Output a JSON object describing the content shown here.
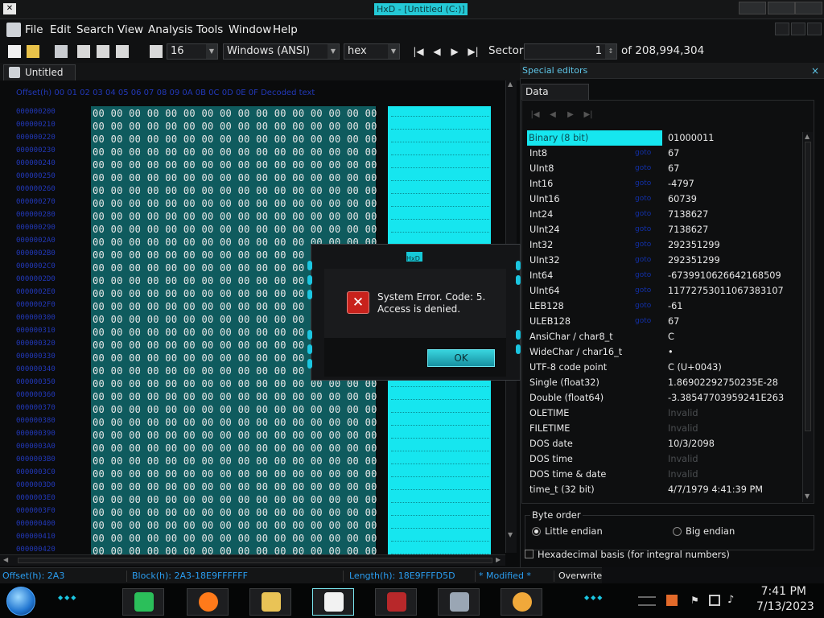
{
  "window": {
    "title": "HxD - [Untitled (C:)]",
    "app_icon": "HxD"
  },
  "menu": [
    "File",
    "Edit",
    "Search",
    "View",
    "Analysis",
    "Tools",
    "Window",
    "Help"
  ],
  "toolbar": {
    "bytes_per_row": "16",
    "charset": "Windows (ANSI)",
    "offset_base": "hex",
    "sector_label": "Sector",
    "sector_value": "1",
    "sector_total": "of 208,994,304"
  },
  "document_tab": "Untitled (C:)",
  "editor": {
    "header": "Offset(h) 00 01 02 03 04 05 06 07 08 09 0A 0B 0C 0D 0E 0F  Decoded text",
    "offsets": [
      "000000200",
      "000000210",
      "000000220",
      "000000230",
      "000000240",
      "000000250",
      "000000260",
      "000000270",
      "000000280",
      "000000290",
      "0000002A0",
      "0000002B0",
      "0000002C0",
      "0000002D0",
      "0000002E0",
      "0000002F0",
      "000000300",
      "000000310",
      "000000320",
      "000000330",
      "000000340",
      "000000350",
      "000000360",
      "000000370",
      "000000380",
      "000000390",
      "0000003A0",
      "0000003B0",
      "0000003C0",
      "0000003D0",
      "0000003E0",
      "0000003F0",
      "000000400",
      "000000410",
      "000000420"
    ],
    "hex_row": "00 00 00 00 00 00 00 00 00 00 00 00 00 00 00 00"
  },
  "special_editors": {
    "title": "Special editors",
    "close": "×",
    "tab": "Data inspector",
    "rows": [
      {
        "label": "Binary (8 bit)",
        "link": "",
        "value": "01000011",
        "invalid": false,
        "selected": true
      },
      {
        "label": "Int8",
        "link": "goto",
        "value": "67",
        "invalid": false
      },
      {
        "label": "UInt8",
        "link": "goto",
        "value": "67",
        "invalid": false
      },
      {
        "label": "Int16",
        "link": "goto",
        "value": "-4797",
        "invalid": false
      },
      {
        "label": "UInt16",
        "link": "goto",
        "value": "60739",
        "invalid": false
      },
      {
        "label": "Int24",
        "link": "goto",
        "value": "7138627",
        "invalid": false
      },
      {
        "label": "UInt24",
        "link": "goto",
        "value": "7138627",
        "invalid": false
      },
      {
        "label": "Int32",
        "link": "goto",
        "value": "292351299",
        "invalid": false
      },
      {
        "label": "UInt32",
        "link": "goto",
        "value": "292351299",
        "invalid": false
      },
      {
        "label": "Int64",
        "link": "goto",
        "value": "-6739910626642168509",
        "invalid": false
      },
      {
        "label": "UInt64",
        "link": "goto",
        "value": "11772753011067383107",
        "invalid": false
      },
      {
        "label": "LEB128",
        "link": "goto",
        "value": "-61",
        "invalid": false
      },
      {
        "label": "ULEB128",
        "link": "goto",
        "value": "67",
        "invalid": false
      },
      {
        "label": "AnsiChar / char8_t",
        "link": "",
        "value": "C",
        "invalid": false
      },
      {
        "label": "WideChar / char16_t",
        "link": "",
        "value": "•",
        "invalid": false
      },
      {
        "label": "UTF-8 code point",
        "link": "",
        "value": "C (U+0043)",
        "invalid": false
      },
      {
        "label": "Single (float32)",
        "link": "",
        "value": "1.86902292750235E-28",
        "invalid": false
      },
      {
        "label": "Double (float64)",
        "link": "",
        "value": "-3.38547703959241E263",
        "invalid": false
      },
      {
        "label": "OLETIME",
        "link": "",
        "value": "Invalid",
        "invalid": true
      },
      {
        "label": "FILETIME",
        "link": "",
        "value": "Invalid",
        "invalid": true
      },
      {
        "label": "DOS date",
        "link": "",
        "value": "10/3/2098",
        "invalid": false
      },
      {
        "label": "DOS time",
        "link": "",
        "value": "Invalid",
        "invalid": true
      },
      {
        "label": "DOS time & date",
        "link": "",
        "value": "Invalid",
        "invalid": true
      },
      {
        "label": "time_t (32 bit)",
        "link": "",
        "value": "4/7/1979 4:41:39 PM",
        "invalid": false
      }
    ],
    "byte_order_title": "Byte order",
    "little_endian": "Little endian",
    "big_endian": "Big endian",
    "hex_basis": "Hexadecimal basis (for integral numbers)"
  },
  "status": {
    "offset": "Offset(h): 2A3",
    "block": "Block(h): 2A3-18E9FFFFFF",
    "length": "Length(h): 18E9FFFD5D",
    "modified": "* Modified *",
    "mode": "Overwrite"
  },
  "dialog": {
    "caption": "HxD",
    "message_line1": "System Error.  Code: 5.",
    "message_line2": "Access is denied.",
    "ok": "OK"
  },
  "clock": {
    "time": "7:41 PM",
    "date": "7/13/2023"
  },
  "colors": {
    "accent": "#16e6ef",
    "hex_bg": "#0f5b5e",
    "error": "#c8221c"
  }
}
